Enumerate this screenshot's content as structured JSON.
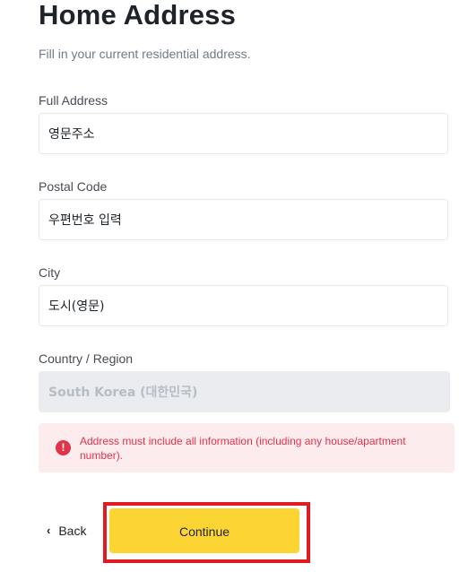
{
  "header": {
    "title": "Home Address",
    "subtitle": "Fill in your current residential address."
  },
  "form": {
    "full_address": {
      "label": "Full Address",
      "value": "영문주소"
    },
    "postal_code": {
      "label": "Postal Code",
      "value": "우편번호 입력"
    },
    "city": {
      "label": "City",
      "value": "도시(영문)"
    },
    "country": {
      "label": "Country / Region",
      "value": "South Korea (대한민국)"
    }
  },
  "alert": {
    "icon": "exclamation-icon",
    "text": "Address must include all information (including any house/apartment number).",
    "color": "#e0344a",
    "background": "#fdecee"
  },
  "actions": {
    "back_icon": "chevron-left-icon",
    "back_label": "Back",
    "continue_label": "Continue",
    "continue_color": "#fcd535",
    "highlight_color": "#e11b22"
  }
}
